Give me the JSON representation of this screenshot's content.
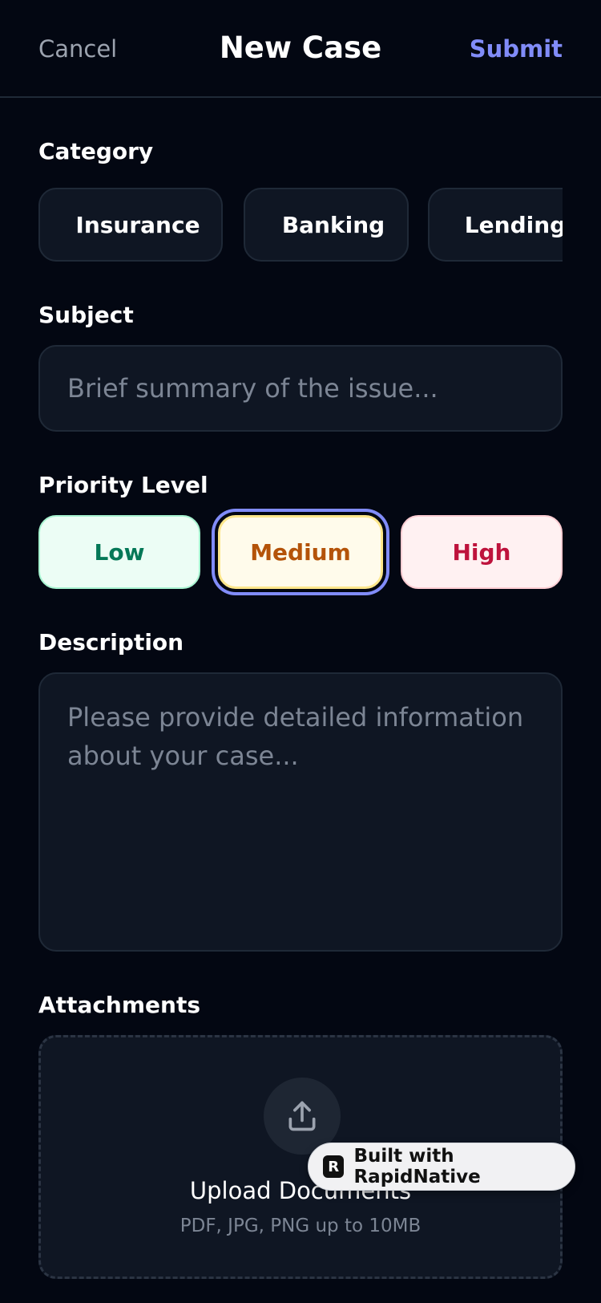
{
  "header": {
    "cancel_label": "Cancel",
    "title": "New Case",
    "submit_label": "Submit"
  },
  "category": {
    "label": "Category",
    "options": [
      "Insurance",
      "Banking",
      "Lending"
    ]
  },
  "subject": {
    "label": "Subject",
    "placeholder": "Brief summary of the issue..."
  },
  "priority": {
    "label": "Priority Level",
    "options": [
      "Low",
      "Medium",
      "High"
    ],
    "selected": "Medium"
  },
  "description": {
    "label": "Description",
    "placeholder": "Please provide detailed information about your case..."
  },
  "attachments": {
    "label": "Attachments",
    "upload_title": "Upload Documents",
    "upload_hint": "PDF, JPG, PNG up to 10MB",
    "icon": "upload-icon"
  },
  "badge": {
    "logo_letter": "R",
    "text": "Built with RapidNative"
  },
  "colors": {
    "background": "#030712",
    "surface": "#0f1623",
    "accent": "#818cf8",
    "low": "#047857",
    "medium": "#b45309",
    "high": "#be123c"
  }
}
